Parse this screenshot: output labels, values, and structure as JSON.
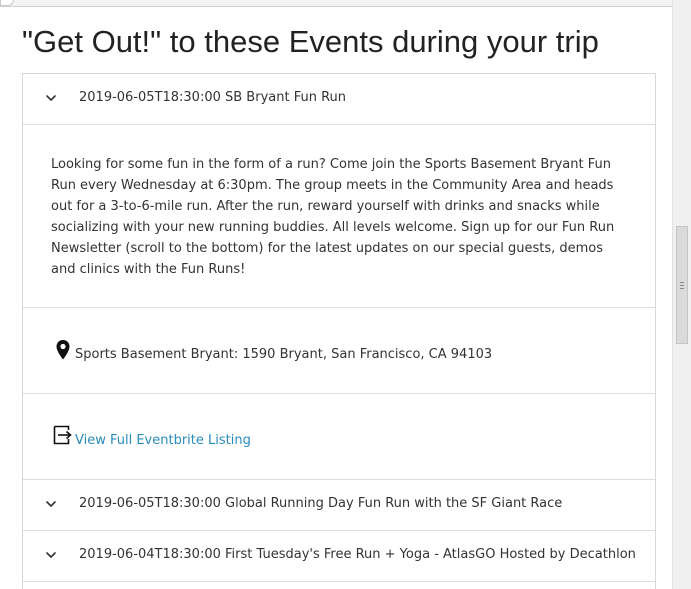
{
  "page": {
    "title": "\"Get Out!\" to these Events during your trip"
  },
  "events": [
    {
      "header": "2019-06-05T18:30:00 SB Bryant Fun Run",
      "expanded": true,
      "description": "Looking for some fun in the form of a run? Come join the Sports Basement Bryant Fun Run every Wednesday at 6:30pm. The group meets in the Community Area and heads out for a 3-to-6-mile run. After the run, reward yourself with drinks and snacks while socializing with your new running buddies. All levels welcome. Sign up for our Fun Run Newsletter (scroll to the bottom) for the latest updates on our special guests, demos and clinics with the Fun Runs!",
      "location": "Sports Basement Bryant: 1590 Bryant, San Francisco, CA 94103",
      "link_label": "View Full Eventbrite Listing"
    },
    {
      "header": "2019-06-05T18:30:00 Global Running Day Fun Run with the SF Giant Race",
      "expanded": false
    },
    {
      "header": "2019-06-04T18:30:00 First Tuesday's Free Run + Yoga - AtlasGO Hosted by Decathlon",
      "expanded": false
    }
  ],
  "icons": {
    "chevron": "chevron-down-icon",
    "location": "map-pin-icon",
    "external": "external-link-icon"
  },
  "colors": {
    "link": "#2a8bbf",
    "text": "#333333",
    "border": "#dddddd"
  }
}
